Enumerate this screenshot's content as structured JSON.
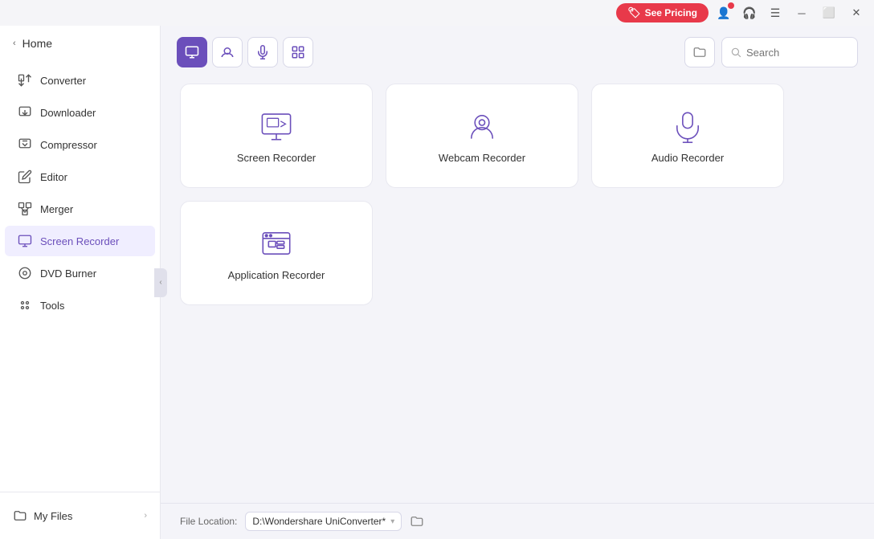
{
  "titleBar": {
    "seePricing": "See Pricing",
    "minimizeTitle": "Minimize",
    "restoreTitle": "Restore",
    "closeTitle": "Close"
  },
  "sidebar": {
    "homeLabel": "Home",
    "navItems": [
      {
        "id": "converter",
        "label": "Converter",
        "icon": "converter"
      },
      {
        "id": "downloader",
        "label": "Downloader",
        "icon": "downloader"
      },
      {
        "id": "compressor",
        "label": "Compressor",
        "icon": "compressor"
      },
      {
        "id": "editor",
        "label": "Editor",
        "icon": "editor"
      },
      {
        "id": "merger",
        "label": "Merger",
        "icon": "merger"
      },
      {
        "id": "screen-recorder",
        "label": "Screen Recorder",
        "icon": "screen-recorder"
      },
      {
        "id": "dvd-burner",
        "label": "DVD Burner",
        "icon": "dvd-burner"
      },
      {
        "id": "tools",
        "label": "Tools",
        "icon": "tools"
      }
    ],
    "myFiles": "My Files"
  },
  "tabBar": {
    "tabs": [
      {
        "id": "screen",
        "icon": "screen"
      },
      {
        "id": "webcam",
        "icon": "webcam"
      },
      {
        "id": "audio",
        "icon": "audio"
      },
      {
        "id": "apps",
        "icon": "apps"
      }
    ],
    "searchPlaceholder": "Search"
  },
  "cards": [
    [
      {
        "id": "screen-recorder",
        "label": "Screen Recorder"
      },
      {
        "id": "webcam-recorder",
        "label": "Webcam Recorder"
      },
      {
        "id": "audio-recorder",
        "label": "Audio Recorder"
      }
    ],
    [
      {
        "id": "application-recorder",
        "label": "Application Recorder"
      }
    ]
  ],
  "bottomBar": {
    "fileLocationLabel": "File Location:",
    "fileLocationPath": "D:\\Wondershare UniConverter*"
  }
}
